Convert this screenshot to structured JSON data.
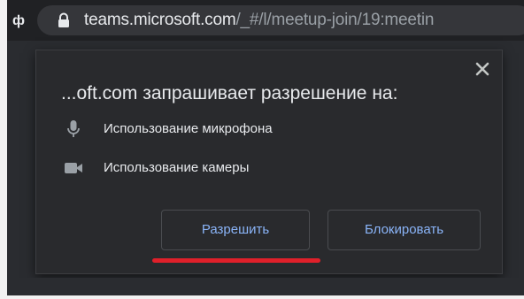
{
  "address_bar": {
    "nav_glyph": "ф",
    "url_host": "teams.microsoft.com",
    "url_path": "/_#/l/meetup-join/19:meetin",
    "lock_icon": "lock-icon"
  },
  "permission_popup": {
    "title": "...oft.com запрашивает разрешение на:",
    "close_icon": "close-icon",
    "permissions": [
      {
        "icon": "microphone-icon",
        "label": "Использование микрофона"
      },
      {
        "icon": "camera-icon",
        "label": "Использование камеры"
      }
    ],
    "allow_label": "Разрешить",
    "block_label": "Блокировать"
  },
  "colors": {
    "popup_background": "#292a2d",
    "button_text": "#8ab4f8",
    "highlight_underline": "#e0202a",
    "primary_text": "#e8eaed",
    "icon_gray": "#9aa0a6"
  }
}
